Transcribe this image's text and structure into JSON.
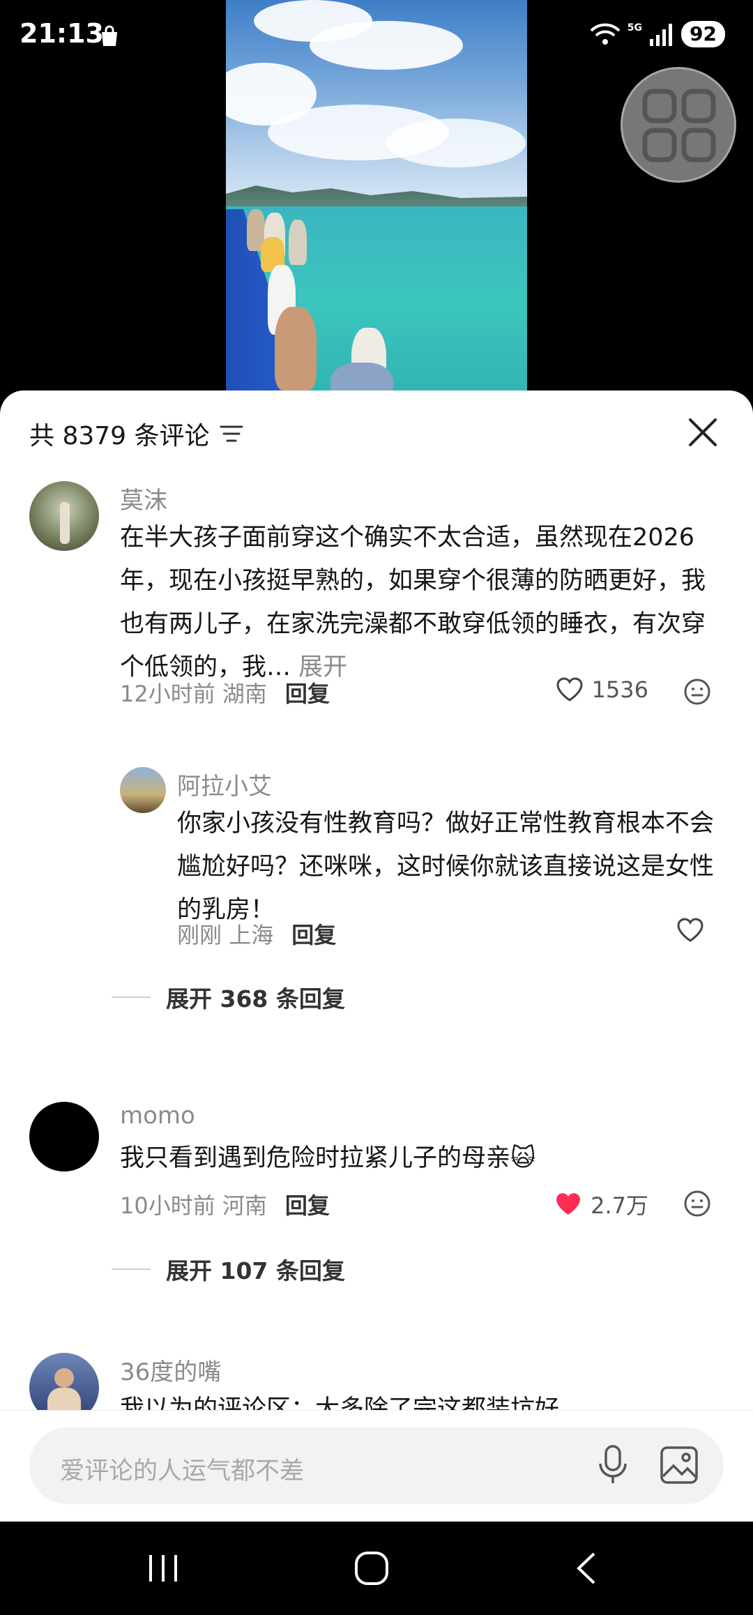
{
  "status_bar": {
    "time": "21:13",
    "battery": "92",
    "network": "5G"
  },
  "header": {
    "comment_count": "共 8379 条评论"
  },
  "comments": [
    {
      "user": "莫沫",
      "text": "在半大孩子面前穿这个确实不太合适，虽然现在2026年，现在小孩挺早熟的，如果穿个很薄的防晒更好，我也有两儿子，在家洗完澡都不敢穿低领的睡衣，有次穿个低领的，我…",
      "expand_label": "展开",
      "time": "12小时前",
      "location": "湖南",
      "reply_label": "回复",
      "likes": "1536",
      "reply": {
        "user": "阿拉小艾",
        "text": "你家小孩没有性教育吗？做好正常性教育根本不会尴尬好吗？还咪咪，这时候你就该直接说这是女性的乳房！",
        "time": "刚刚",
        "location": "上海",
        "reply_label": "回复"
      },
      "expand_replies": "展开 368 条回复"
    },
    {
      "user": "momo",
      "text": "我只看到遇到危险时拉紧儿子的母亲",
      "emoji": "🙀",
      "time": "10小时前",
      "location": "河南",
      "reply_label": "回复",
      "likes": "2.7万",
      "liked": true,
      "expand_replies": "展开 107 条回复"
    },
    {
      "user": "36度的嘴",
      "text": "我以为的评论区：大多除了完这都装坑好"
    }
  ],
  "input": {
    "placeholder": "爱评论的人运气都不差"
  },
  "colors": {
    "like_red": "#fe2c55",
    "muted": "#8a8a8a"
  }
}
